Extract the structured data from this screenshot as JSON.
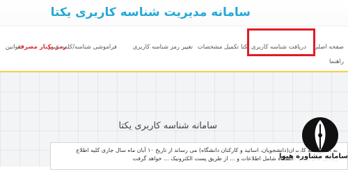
{
  "header": {
    "title": "سامانه مدیریت شناسه کاربری یکتا"
  },
  "nav": {
    "items": [
      {
        "label": "صفحه اصلی"
      },
      {
        "label": "دریافت شناسه کاربری یکتا"
      },
      {
        "label": "تکمیل مشخصات"
      },
      {
        "label": "تغییر رمز شناسه کاربری"
      },
      {
        "label": "فراموشی شناسه/کلمه عبور"
      },
      {
        "label": "رمز یکبار مصرف"
      },
      {
        "label": "قوانین"
      },
      {
        "label": "راهنما"
      }
    ]
  },
  "main": {
    "title": "سامانه شناسه کاربری یکتا",
    "notice": "به اطلاع کلیه کاربران(دانشجویان، اساتید و کارکنان دانشگاه) می رساند از تاریخ ۱۰ آبان ماه سال جاری کلیه اطلاع رسانی های پرتال دانشگاه شامل اطلاعات و ... از طریق پست الکترونیک ... خواهد گرفت"
  },
  "watermark": {
    "text": "سامانه مشاوره هیوا"
  },
  "colors": {
    "title": "#24a8d6",
    "highlight": "#e01b24",
    "stripe": "#f5d44a",
    "red_link": "#e0262d"
  }
}
